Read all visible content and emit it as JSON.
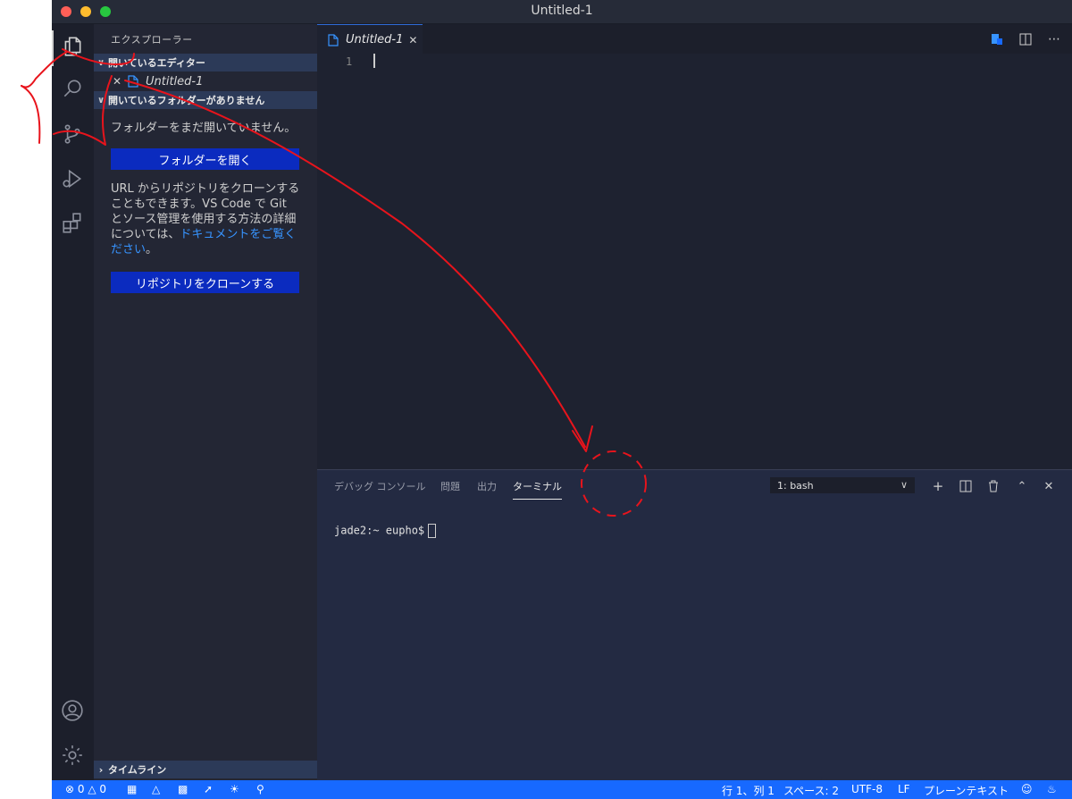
{
  "window": {
    "title": "Untitled-1",
    "traffic_colors": [
      "#ff5f57",
      "#febc2e",
      "#28c840"
    ]
  },
  "activity_bar": {
    "icons": [
      "files-icon",
      "search-icon",
      "source-control-icon",
      "run-debug-icon",
      "extensions-icon"
    ],
    "bottom_icons": [
      "account-icon",
      "gear-icon"
    ]
  },
  "sidebar": {
    "title": "エクスプローラー",
    "open_editors": {
      "header": "開いているエディター",
      "items": [
        {
          "label": "Untitled-1"
        }
      ]
    },
    "no_folder": {
      "header": "開いているフォルダーがありません",
      "message": "フォルダーをまだ開いていません。",
      "open_folder_button": "フォルダーを開く",
      "clone_text_before": "URL からリポジトリをクローンすることもできます。VS Code で Git とソース管理を使用する方法の詳細については、",
      "clone_link": "ドキュメントをご覧ください",
      "clone_text_after": "。",
      "clone_button": "リポジトリをクローンする"
    },
    "timeline": {
      "header": "タイムライン"
    }
  },
  "editor": {
    "tab_label": "Untitled-1",
    "line_numbers": [
      "1"
    ],
    "content": ""
  },
  "panel": {
    "tabs": [
      {
        "label": "デバッグ コンソール",
        "active": false
      },
      {
        "label": "問題",
        "active": false
      },
      {
        "label": "出力",
        "active": false
      },
      {
        "label": "ターミナル",
        "active": true
      }
    ],
    "terminal_select": "1: bash",
    "terminal_prompt": "jade2:~ eupho$"
  },
  "status_bar": {
    "errors": "0",
    "warnings": "0",
    "position": "行 1、列 1",
    "spaces": "スペース: 2",
    "encoding": "UTF-8",
    "eol": "LF",
    "language": "プレーンテキスト"
  },
  "colors": {
    "accent": "#1769ff",
    "button": "#0b2bbf",
    "link": "#3794ff",
    "annotation": "#e8141c"
  }
}
